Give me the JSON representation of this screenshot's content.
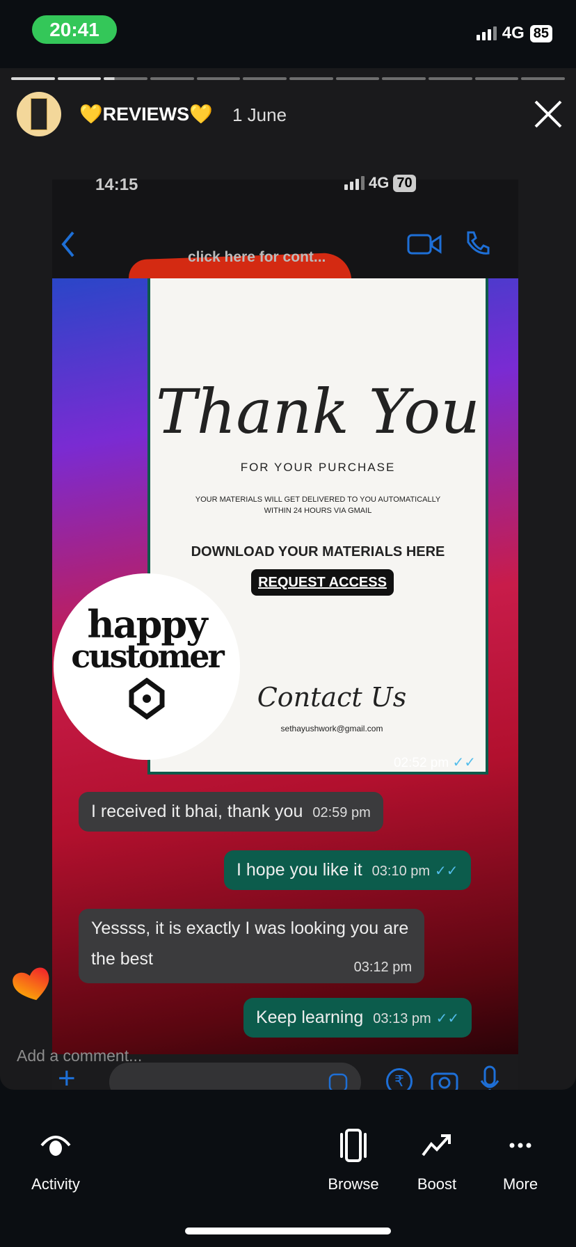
{
  "status_bar": {
    "time": "20:41",
    "network": "4G",
    "battery": "85"
  },
  "story": {
    "title": "💛REVIEWS💛",
    "date": "1 June",
    "segments_total": 12,
    "segments_viewed": 2,
    "current_segment_progress": 0.25
  },
  "screenshot": {
    "status": {
      "time": "14:15",
      "network": "4G",
      "battery": "70"
    },
    "contact_subtitle": "click here for cont...",
    "card": {
      "heading": "Thank You",
      "subheading": "FOR YOUR PURCHASE",
      "note_line1": "YOUR MATERIALS WILL GET DELIVERED TO YOU AUTOMATICALLY",
      "note_line2": "WITHIN 24 HOURS VIA GMAIL",
      "download": "DOWNLOAD YOUR MATERIALS HERE",
      "request": "REQUEST ACCESS",
      "contact": "Contact Us",
      "email": "sethayushwork@gmail.com",
      "time": "02:52 pm"
    },
    "sticker": {
      "line1": "happy",
      "line2": "customer"
    },
    "messages": [
      {
        "dir": "in",
        "text": "I received it bhai, thank you",
        "time": "02:59 pm"
      },
      {
        "dir": "out",
        "text": "I hope you like it",
        "time": "03:10 pm"
      },
      {
        "dir": "in",
        "text": "Yessss, it is exactly I was looking you are the best",
        "time": "03:12 pm"
      },
      {
        "dir": "out",
        "text": "Keep learning",
        "time": "03:13 pm"
      }
    ]
  },
  "comment_placeholder": "Add a comment...",
  "nav": [
    {
      "label": "Activity",
      "icon": "activity-eye-icon"
    },
    {
      "label": "Browse",
      "icon": "browse-phone-icon"
    },
    {
      "label": "Boost",
      "icon": "trending-up-icon"
    },
    {
      "label": "More",
      "icon": "more-dots-icon"
    }
  ],
  "colors": {
    "accent_blue": "#1e6fd6",
    "outgoing_bubble": "#0c5c4c",
    "status_pill": "#34c759"
  }
}
